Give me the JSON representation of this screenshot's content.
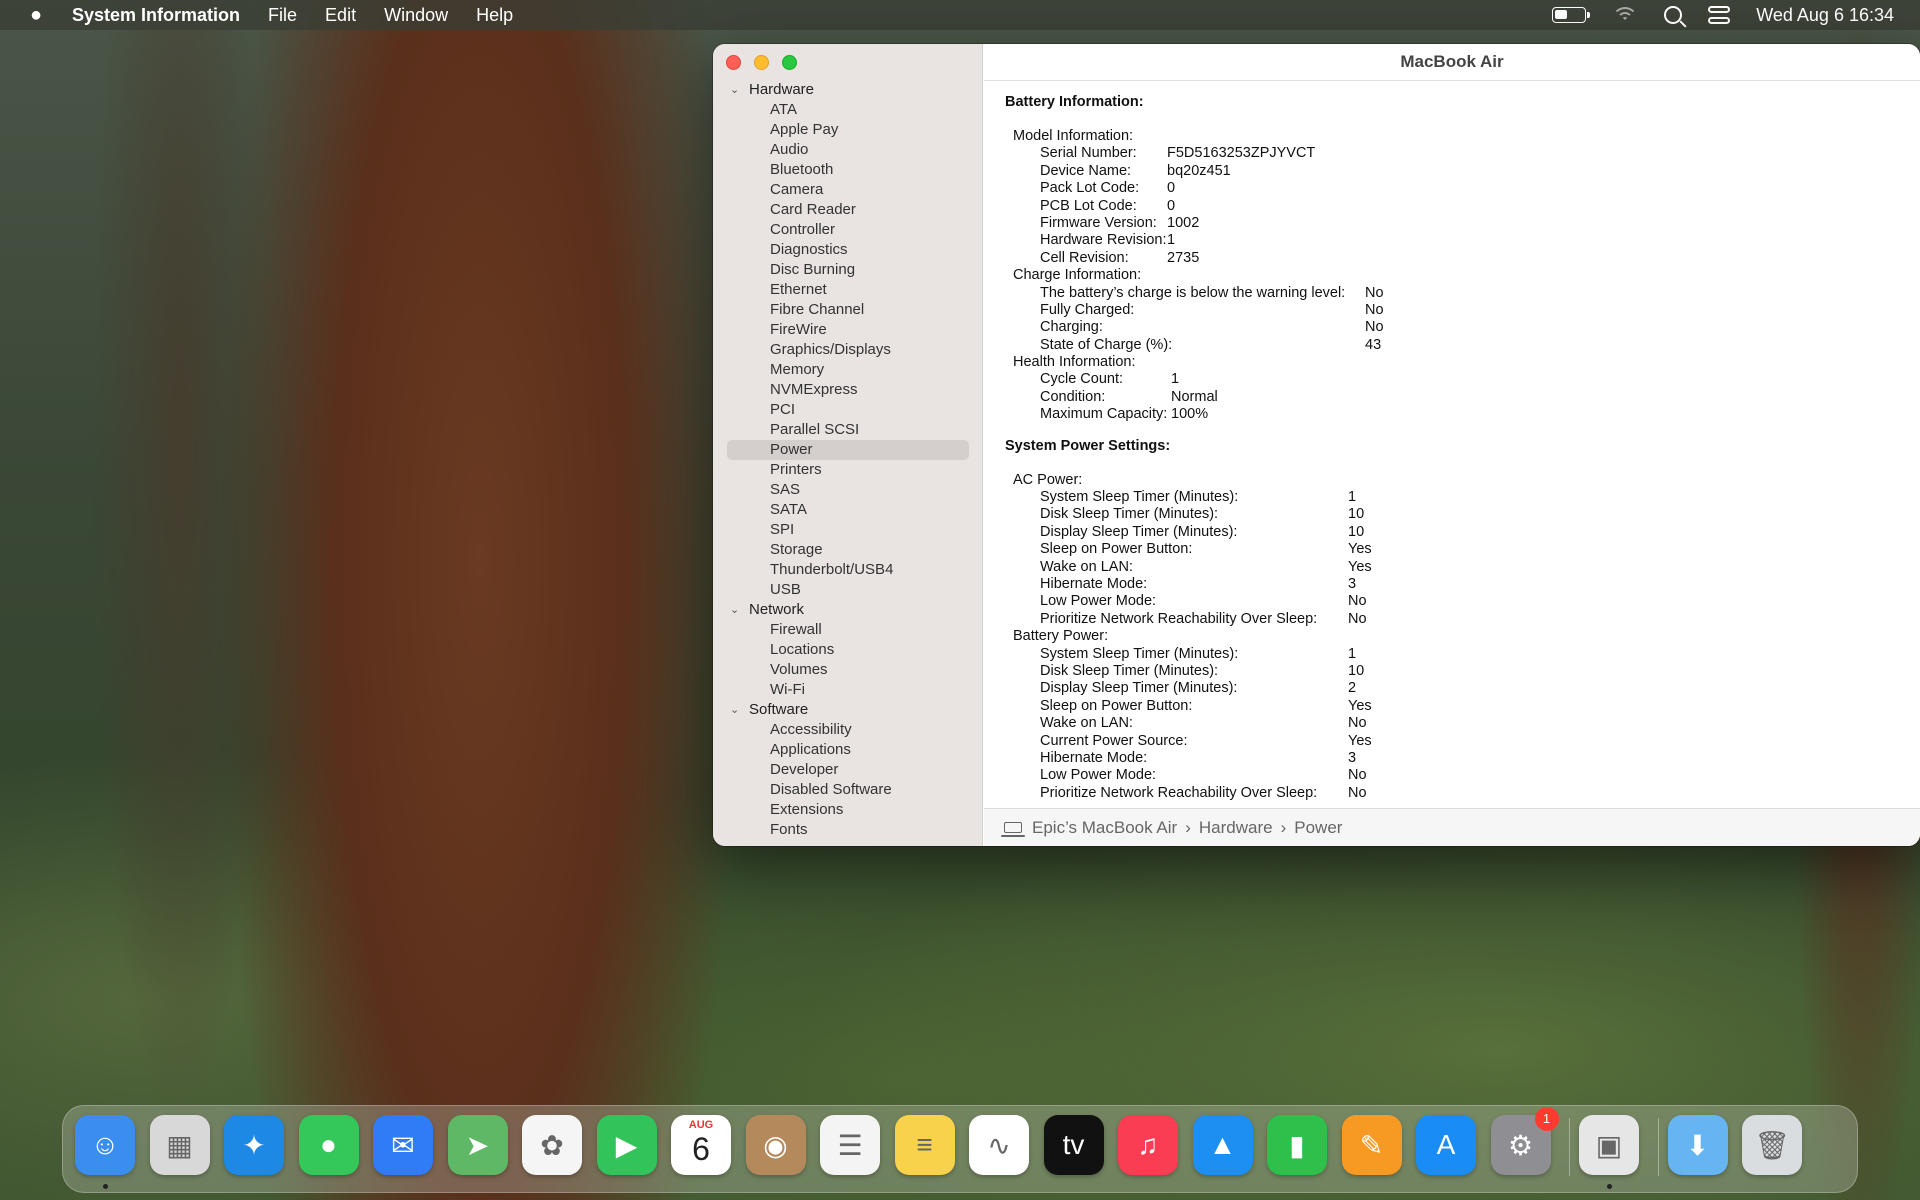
{
  "menubar": {
    "app_name": "System Information",
    "menus": [
      "File",
      "Edit",
      "Window",
      "Help"
    ],
    "clock": "Wed Aug 6  16:34",
    "battery_level": 0.43
  },
  "window": {
    "title": "MacBook Air"
  },
  "sidebar": {
    "groups": [
      {
        "label": "Hardware",
        "items": [
          "ATA",
          "Apple Pay",
          "Audio",
          "Bluetooth",
          "Camera",
          "Card Reader",
          "Controller",
          "Diagnostics",
          "Disc Burning",
          "Ethernet",
          "Fibre Channel",
          "FireWire",
          "Graphics/Displays",
          "Memory",
          "NVMExpress",
          "PCI",
          "Parallel SCSI",
          "Power",
          "Printers",
          "SAS",
          "SATA",
          "SPI",
          "Storage",
          "Thunderbolt/USB4",
          "USB"
        ]
      },
      {
        "label": "Network",
        "items": [
          "Firewall",
          "Locations",
          "Volumes",
          "Wi-Fi"
        ]
      },
      {
        "label": "Software",
        "items": [
          "Accessibility",
          "Applications",
          "Developer",
          "Disabled Software",
          "Extensions",
          "Fonts"
        ]
      }
    ],
    "selected": "Power"
  },
  "battery": {
    "title": "Battery Information:",
    "model": {
      "label": "Model Information:",
      "rows": [
        {
          "k": "Serial Number:",
          "v": "F5D5163253ZPJYVCT"
        },
        {
          "k": "Device Name:",
          "v": "bq20z451"
        },
        {
          "k": "Pack Lot Code:",
          "v": "0"
        },
        {
          "k": "PCB Lot Code:",
          "v": "0"
        },
        {
          "k": "Firmware Version:",
          "v": "1002"
        },
        {
          "k": "Hardware Revision:",
          "v": "1"
        },
        {
          "k": "Cell Revision:",
          "v": "2735"
        }
      ]
    },
    "charge": {
      "label": "Charge Information:",
      "rows": [
        {
          "k": "The battery’s charge is below the warning level:",
          "v": "No"
        },
        {
          "k": "Fully Charged:",
          "v": "No"
        },
        {
          "k": "Charging:",
          "v": "No"
        },
        {
          "k": "State of Charge (%):",
          "v": "43"
        }
      ]
    },
    "health": {
      "label": "Health Information:",
      "rows": [
        {
          "k": "Cycle Count:",
          "v": "1"
        },
        {
          "k": "Condition:",
          "v": "Normal"
        },
        {
          "k": "Maximum Capacity:",
          "v": "100%"
        }
      ]
    }
  },
  "power_settings": {
    "title": "System Power Settings:",
    "ac": {
      "label": "AC Power:",
      "rows": [
        {
          "k": "System Sleep Timer (Minutes):",
          "v": "1"
        },
        {
          "k": "Disk Sleep Timer (Minutes):",
          "v": "10"
        },
        {
          "k": "Display Sleep Timer (Minutes):",
          "v": "10"
        },
        {
          "k": "Sleep on Power Button:",
          "v": "Yes"
        },
        {
          "k": "Wake on LAN:",
          "v": "Yes"
        },
        {
          "k": "Hibernate Mode:",
          "v": "3"
        },
        {
          "k": "Low Power Mode:",
          "v": "No"
        },
        {
          "k": "Prioritize Network Reachability Over Sleep:",
          "v": "No"
        }
      ]
    },
    "battery_power": {
      "label": "Battery Power:",
      "rows": [
        {
          "k": "System Sleep Timer (Minutes):",
          "v": "1"
        },
        {
          "k": "Disk Sleep Timer (Minutes):",
          "v": "10"
        },
        {
          "k": "Display Sleep Timer (Minutes):",
          "v": "2"
        },
        {
          "k": "Sleep on Power Button:",
          "v": "Yes"
        },
        {
          "k": "Wake on LAN:",
          "v": "No"
        },
        {
          "k": "Current Power Source:",
          "v": "Yes"
        },
        {
          "k": "Hibernate Mode:",
          "v": "3"
        },
        {
          "k": "Low Power Mode:",
          "v": "No"
        },
        {
          "k": "Prioritize Network Reachability Over Sleep:",
          "v": "No"
        }
      ]
    }
  },
  "pathbar": {
    "segments": [
      "Epic’s MacBook Air",
      "Hardware",
      "Power"
    ],
    "separator": "›"
  },
  "dock": {
    "apps": [
      {
        "name": "finder-icon",
        "color": "#3a8ef0",
        "glyph": "☺",
        "running": true
      },
      {
        "name": "launchpad-icon",
        "color": "#d8d8d8",
        "glyph": "▦",
        "running": false
      },
      {
        "name": "safari-icon",
        "color": "#1e88e5",
        "glyph": "✦",
        "running": false
      },
      {
        "name": "messages-icon",
        "color": "#34c759",
        "glyph": "●",
        "running": false
      },
      {
        "name": "mail-icon",
        "color": "#2f7cf6",
        "glyph": "✉",
        "running": false
      },
      {
        "name": "maps-icon",
        "color": "#5fb865",
        "glyph": "➤",
        "running": false
      },
      {
        "name": "photos-icon",
        "color": "#f5f5f5",
        "glyph": "✿",
        "running": false
      },
      {
        "name": "facetime-icon",
        "color": "#32c45a",
        "glyph": "▶",
        "running": false
      },
      {
        "name": "calendar-icon",
        "color": "#ffffff",
        "glyph": "",
        "running": false
      },
      {
        "name": "contacts-icon",
        "color": "#b48a5c",
        "glyph": "◉",
        "running": false
      },
      {
        "name": "reminders-icon",
        "color": "#f4f4f4",
        "glyph": "☰",
        "running": false
      },
      {
        "name": "notes-icon",
        "color": "#f7d24a",
        "glyph": "≡",
        "running": false
      },
      {
        "name": "freeform-icon",
        "color": "#ffffff",
        "glyph": "∿",
        "running": false
      },
      {
        "name": "tv-icon",
        "color": "#111111",
        "glyph": "tv",
        "running": false
      },
      {
        "name": "music-icon",
        "color": "#fa3d52",
        "glyph": "♫",
        "running": false
      },
      {
        "name": "keynote-icon",
        "color": "#1d8ff2",
        "glyph": "▲",
        "running": false
      },
      {
        "name": "numbers-icon",
        "color": "#2fbf4b",
        "glyph": "▮",
        "running": false
      },
      {
        "name": "pages-icon",
        "color": "#f79a24",
        "glyph": "✎",
        "running": false
      },
      {
        "name": "app-store-icon",
        "color": "#1a8cf5",
        "glyph": "A",
        "running": false
      },
      {
        "name": "system-settings-icon",
        "color": "#8e8e93",
        "glyph": "⚙",
        "running": false,
        "badge": "1"
      },
      {
        "name": "system-information-icon",
        "color": "#e6e6e6",
        "glyph": "▣",
        "running": true
      },
      {
        "name": "downloads-folder-icon",
        "color": "#66b4f2",
        "glyph": "⬇",
        "running": false
      },
      {
        "name": "trash-icon",
        "color": "#d9dde0",
        "glyph": "🗑",
        "running": false
      }
    ],
    "calendar": {
      "month": "AUG",
      "day": "6"
    }
  }
}
